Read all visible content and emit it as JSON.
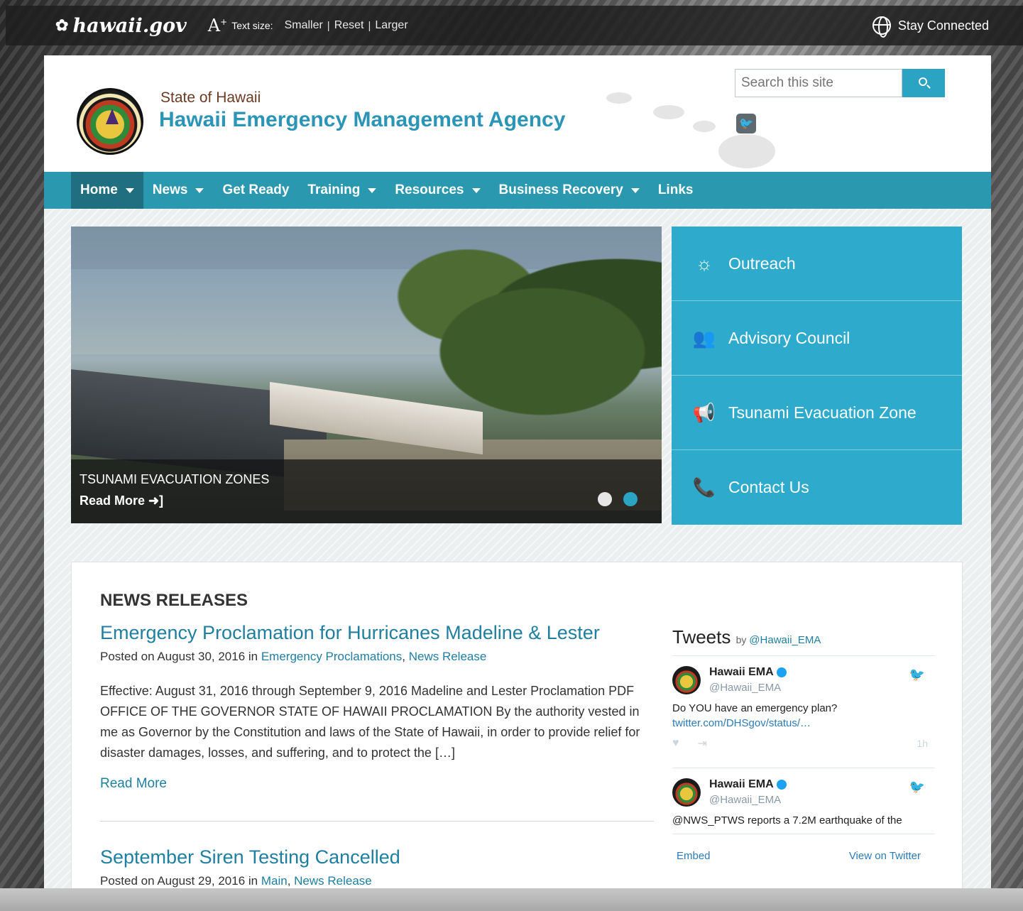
{
  "topbar": {
    "logo": "hawaii.gov",
    "text_size_label": "Text size:",
    "smaller": "Smaller",
    "reset": "Reset",
    "larger": "Larger",
    "separator": "|",
    "stay_connected": "Stay Connected"
  },
  "header": {
    "subtitle": "State of Hawaii",
    "title": "Hawaii Emergency Management Agency",
    "search_placeholder": "Search this site"
  },
  "nav": {
    "items": [
      {
        "label": "Home",
        "dropdown": true,
        "active": true
      },
      {
        "label": "News",
        "dropdown": true
      },
      {
        "label": "Get Ready",
        "dropdown": false
      },
      {
        "label": "Training",
        "dropdown": true
      },
      {
        "label": "Resources",
        "dropdown": true
      },
      {
        "label": "Business Recovery",
        "dropdown": true
      },
      {
        "label": "Links",
        "dropdown": false
      }
    ]
  },
  "hero": {
    "caption_title": "TSUNAMI EVACUATION ZONES",
    "read_more": "Read More ➜]",
    "slides": 2,
    "active_slide": 2
  },
  "quick_links": [
    {
      "label": "Outreach",
      "icon": "sunrise-icon",
      "glyph": "☼"
    },
    {
      "label": "Advisory Council",
      "icon": "group-icon",
      "glyph": "👥"
    },
    {
      "label": "Tsunami Evacuation Zone",
      "icon": "megaphone-icon",
      "glyph": "📢"
    },
    {
      "label": "Contact Us",
      "icon": "phone-icon",
      "glyph": "📞"
    }
  ],
  "news": {
    "heading": "NEWS RELEASES",
    "posts": [
      {
        "title": "Emergency Proclamation for Hurricanes Madeline & Lester",
        "posted_prefix": "Posted on August 30, 2016 in ",
        "category1": "Emergency Proclamations",
        "cat_sep": ", ",
        "category2": "News Release",
        "excerpt": "Effective: August 31, 2016 through September 9, 2016 Madeline and Lester Proclamation PDF      OFFICE OF THE GOVERNOR STATE OF HAWAII PROCLAMATION By the authority vested in me as Governor by the Constitution and laws of the State of Hawaii, in order to provide relief for disaster damages, losses, and suffering, and to protect the […]",
        "read_more": "Read More"
      },
      {
        "title": "September Siren Testing Cancelled",
        "posted_prefix": "Posted on August 29, 2016 in ",
        "category1": "Main",
        "cat_sep": ", ",
        "category2": "News Release"
      }
    ]
  },
  "tweets": {
    "title": "Tweets",
    "by": "by",
    "by_handle": "@Hawaii_EMA",
    "items": [
      {
        "name": "Hawaii EMA",
        "handle": "@Hawaii_EMA",
        "text": "Do YOU have an emergency plan?",
        "link": "twitter.com/DHSgov/status/…",
        "time": "1h"
      },
      {
        "name": "Hawaii EMA",
        "handle": "@Hawaii_EMA",
        "text": "@NWS_PTWS reports a 7.2M earthquake of the"
      }
    ],
    "embed": "Embed",
    "view_on_twitter": "View on Twitter"
  },
  "colors": {
    "accent": "#2ba3c2",
    "nav": "#2a99b0",
    "nav_active": "#1f6f80",
    "link": "#1f7fa0",
    "agency_title": "#2b95b8"
  }
}
